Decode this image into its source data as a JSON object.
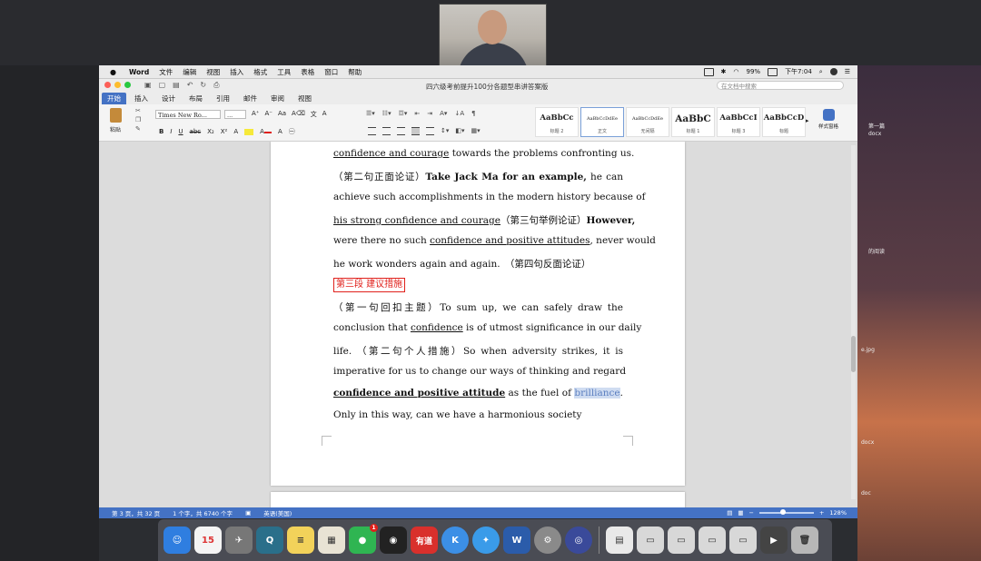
{
  "menubar": {
    "app_name": "Word",
    "items": [
      "文件",
      "编辑",
      "视图",
      "插入",
      "格式",
      "工具",
      "表格",
      "窗口",
      "帮助"
    ],
    "battery": "99%",
    "clock": "下午7:04"
  },
  "window": {
    "doc_title": "四六级考前提升100分各题型串讲答案版",
    "search_placeholder": "在文档中搜索"
  },
  "tabs": [
    "开始",
    "插入",
    "设计",
    "布局",
    "引用",
    "邮件",
    "审阅",
    "视图"
  ],
  "ribbon": {
    "paste_label": "粘贴",
    "font_name": "Times New Ro...",
    "font_size": "...",
    "styles": [
      {
        "sample": "AaBbCc",
        "name": "标题 2"
      },
      {
        "sample": "AaBbCcDdEe",
        "name": "正文"
      },
      {
        "sample": "AaBbCcDdEe",
        "name": "无间隔"
      },
      {
        "sample": "AaBbC",
        "name": "标题 1"
      },
      {
        "sample": "AaBbCcI",
        "name": "标题 3"
      },
      {
        "sample": "AaBbCcD",
        "name": "标题"
      }
    ],
    "styles_pane_label": "样式窗格"
  },
  "doc": {
    "l1": {
      "u1": "confidence and courage",
      "t1": " towards the problems confronting us."
    },
    "l2": {
      "t1": "（第二句正面论证）",
      "b1": "Take Jack Ma for an example,",
      "t2": " he can"
    },
    "l3": {
      "t1": "achieve such accomplishments in the modern history because of"
    },
    "l4": {
      "u1": "his strong confidence and courage",
      "t1": "（第三句举例论证）",
      "b1": "However,"
    },
    "l5": {
      "t1": "were there no such ",
      "u1": "confidence and positive attitudes",
      "t2": ", never would"
    },
    "l6": {
      "t1": "he work wonders again and again.　（第四句反面论证）"
    },
    "l7": {
      "tag": "第三段  建议措施"
    },
    "l8": {
      "t1": "（第一句回扣主题）To sum up, we can safely draw the"
    },
    "l9": {
      "t1": "conclusion that ",
      "u1": "confidence",
      "t2": " is of utmost significance in our daily"
    },
    "l10": {
      "t1": "life. （第二句个人措施）So when adversity strikes, it is"
    },
    "l11": {
      "t1": "imperative for us to change our ways of thinking and regard"
    },
    "l12": {
      "bu1": "confidence and positive attitude",
      "t1": " as the fuel of ",
      "sel": "brilliance",
      "t2": "."
    },
    "l13": {
      "t1": "Only in this way, can we have a harmonious society"
    }
  },
  "statusbar": {
    "page": "第 3 页，共 32 页",
    "words": "1 个字，共 6740 个字",
    "lang": "英语(美国)",
    "zoom": "128%",
    "zoom_fraction": 0.42
  },
  "dock": {
    "calendar_day": "15",
    "badge_count": "1",
    "youdao_label": "有道",
    "k_label": "K",
    "word_label": "W"
  },
  "desktop": {
    "label_1": "第一篇",
    "label_2": "docx",
    "label_3": "的阅读",
    "label_4": "e.jpg",
    "label_5": "docx",
    "label_6": "doc"
  }
}
